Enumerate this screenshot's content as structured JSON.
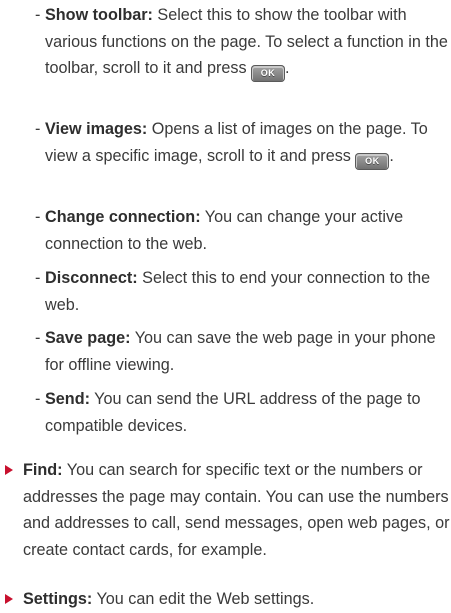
{
  "sub_items": [
    {
      "term": "Show toolbar:",
      "text_before_key": " Select this to show the toolbar with various functions on the page. To select a function in the toolbar, scroll to it and press ",
      "key": "OK",
      "text_after_key": "."
    },
    {
      "term": "View images:",
      "text_before_key": " Opens a list of images on the page. To view a specific image, scroll to it and press ",
      "key": "OK",
      "text_after_key": "."
    },
    {
      "term": "Change connection:",
      "text": " You can change your active connection to the web."
    },
    {
      "term": "Disconnect:",
      "text": " Select this to end your connection to the web."
    },
    {
      "term": "Save page:",
      "text": " You can save the web page in your phone for offline viewing."
    },
    {
      "term": "Send:",
      "text": " You can send the URL address of the page to compatible devices."
    }
  ],
  "main_items": [
    {
      "term": "Find:",
      "text": " You can search for specific text or the numbers or addresses the page may contain. You can use the numbers and addresses to call, send messages, open web pages, or create contact cards, for example."
    },
    {
      "term": "Settings:",
      "text": " You can edit the Web settings."
    }
  ],
  "dash": "-",
  "colors": {
    "text": "#3a3a3a",
    "bullet": "#c8102e",
    "key": "#7a7a7a"
  }
}
